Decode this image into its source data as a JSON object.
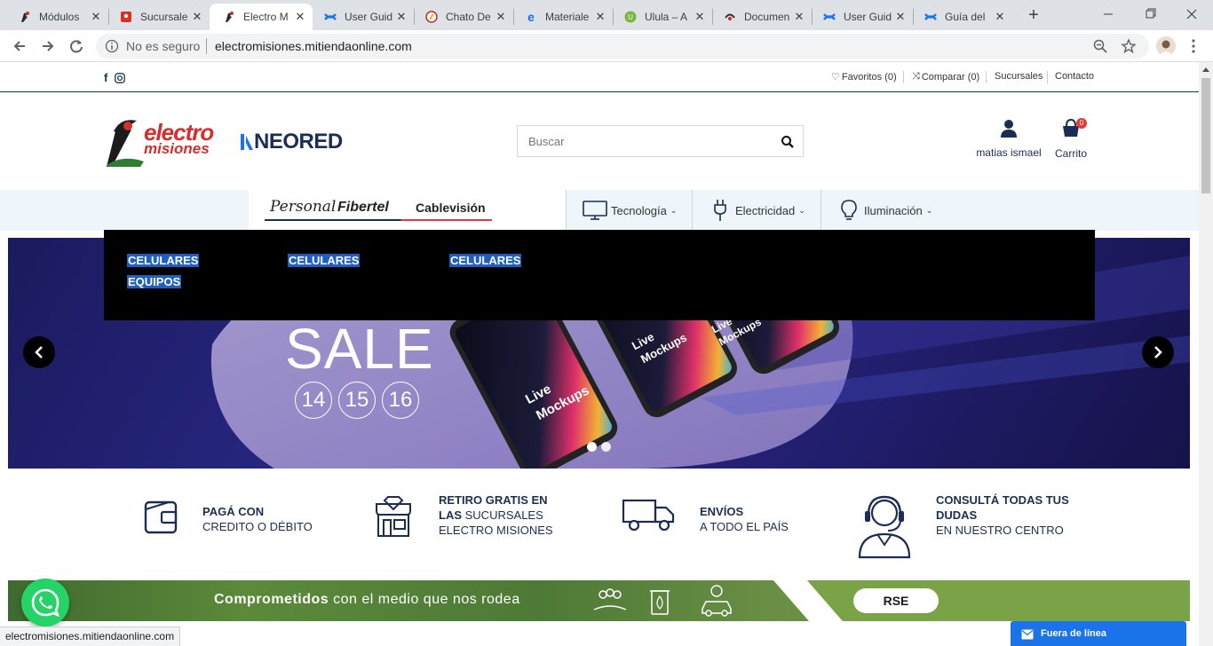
{
  "browser": {
    "tabs": [
      {
        "title": "Módulos",
        "icon": "electromisiones-favicon"
      },
      {
        "title": "Sucursale",
        "icon": "maps-pin-icon"
      },
      {
        "title": "Electro M",
        "icon": "electromisiones-favicon"
      },
      {
        "title": "User Guid",
        "icon": "confluence-icon"
      },
      {
        "title": "Chato De",
        "icon": "chato-icon"
      },
      {
        "title": "Materiale",
        "icon": "ie-icon"
      },
      {
        "title": "Ulula – A",
        "icon": "ulula-icon"
      },
      {
        "title": "Documen",
        "icon": "doc-icon"
      },
      {
        "title": "User Guid",
        "icon": "confluence-icon"
      },
      {
        "title": "Guía del",
        "icon": "confluence-icon"
      }
    ],
    "security_label": "No es seguro",
    "url": "electromisiones.mitiendaonline.com",
    "status_url": "electromisiones.mitiendaonline.com"
  },
  "topbar": {
    "favoritos": "Favoritos (0)",
    "comparar": "Comparar (0)",
    "sucursales": "Sucursales",
    "contacto": "Contacto"
  },
  "header": {
    "logo_top": "electro",
    "logo_bottom": "misiones",
    "partner": "NEORED",
    "search_placeholder": "Buscar",
    "user_name": "matias ismael",
    "cart_label": "Carrito",
    "cart_count": "0"
  },
  "nav": {
    "brands": [
      "Personal",
      "Fibertel",
      "Cablevisión"
    ],
    "items": [
      {
        "label": "Tecnología",
        "icon": "monitor-icon"
      },
      {
        "label": "Electricidad",
        "icon": "plug-icon"
      },
      {
        "label": "Iluminación",
        "icon": "bulb-icon"
      }
    ]
  },
  "mega_menu": {
    "links": [
      "CELULARES",
      "EQUIPOS",
      "CELULARES",
      "CELULARES"
    ]
  },
  "hero": {
    "sale": "SALE",
    "days": [
      "14",
      "15",
      "16"
    ],
    "phone_text": [
      "Live",
      "Mockups"
    ],
    "dots_count": 2
  },
  "features": [
    {
      "title": "PAGÁ CON",
      "sub": "CREDITO O DÉBITO",
      "icon": "wallet-icon"
    },
    {
      "title": "RETIRO GRATIS EN",
      "sub": "LAS SUCURSALES ELECTRO MISIONES",
      "title_suffix_line": "LAS",
      "icon": "store-icon"
    },
    {
      "title": "ENVÍOS",
      "sub": "A TODO EL PAÍS",
      "icon": "truck-icon"
    },
    {
      "title": "CONSULTÁ TODAS TUS DUDAS",
      "sub": "EN NUESTRO CENTRO",
      "icon": "headset-agent-icon"
    }
  ],
  "banner": {
    "bold": "Comprometidos",
    "rest": "con el medio que nos rodea",
    "button": "RSE"
  },
  "chat": {
    "label": "Fuera de línea"
  }
}
